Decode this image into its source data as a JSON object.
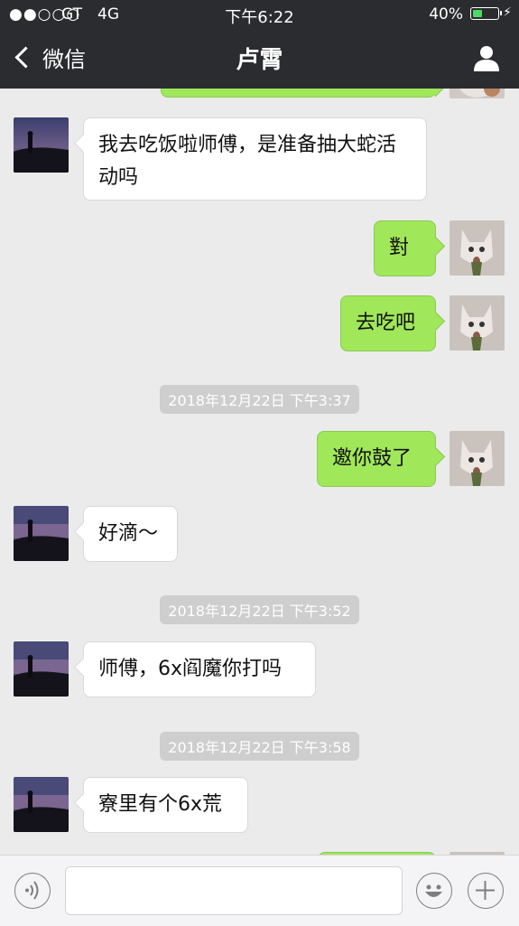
{
  "status_bar": {
    "signal": "●●○○○",
    "carrier": "GT",
    "network": "4G",
    "time": "下午6:22",
    "battery_percent": "40%",
    "battery_level": 0.4,
    "battery_color": "#4cd964",
    "charging_icon": "⚡"
  },
  "nav": {
    "back_label": "微信",
    "title": "卢霄",
    "profile_icon": "person-icon"
  },
  "messages": [
    {
      "side": "out",
      "text": ""
    },
    {
      "side": "in",
      "text": "我去吃饭啦师傅，是准备抽大蛇活动吗"
    },
    {
      "side": "out",
      "text": "對"
    },
    {
      "side": "out",
      "text": "去吃吧"
    },
    {
      "timestamp": "2018年12月22日 下午3:37"
    },
    {
      "side": "out",
      "text": "邀你鼓了"
    },
    {
      "side": "in",
      "text": "好滴～"
    },
    {
      "timestamp": "2018年12月22日 下午3:52"
    },
    {
      "side": "in",
      "text": "师傅，6x阎魔你打吗"
    },
    {
      "timestamp": "2018年12月22日 下午3:58"
    },
    {
      "side": "in",
      "text": "寮里有个6x荒"
    },
    {
      "side": "out",
      "text": ""
    }
  ],
  "input_bar": {
    "voice_icon": "voice-icon",
    "text_value": "",
    "emoji_icon": "emoji-icon",
    "plus_icon": "plus-icon"
  },
  "colors": {
    "header": "#2b2c30",
    "chat_background": "#ebebeb",
    "outgoing_bubble": "#a0e75a",
    "incoming_bubble": "#ffffff",
    "timestamp_bg": "#cecece"
  }
}
